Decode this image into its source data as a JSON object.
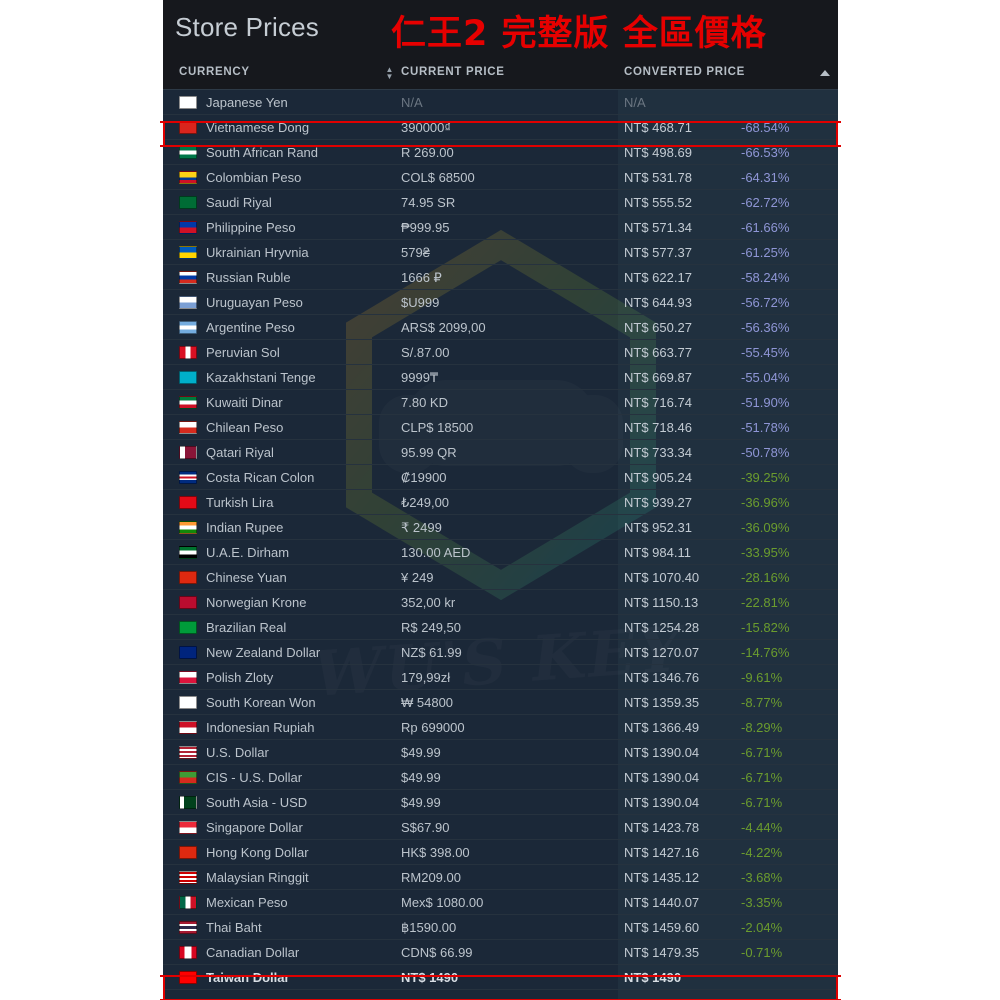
{
  "header": {
    "store_title": "Store Prices",
    "overlay_title": "仁王2 完整版 全區價格",
    "overlay_title_color": "#e60000",
    "columns": {
      "currency": "CURRENCY",
      "current_price": "CURRENT PRICE",
      "converted_price": "CONVERTED PRICE"
    },
    "sort_icons": {
      "currency_sort": "sort-updown-icon",
      "converted_sort": "sort-ascending-icon"
    }
  },
  "watermark": {
    "text": "WU'S KEY",
    "logo": "hexagon-gamepad-logo"
  },
  "colors": {
    "panel_bg": "#1b2838",
    "header_bg": "#16181d",
    "column_highlight_bg": "#20303f",
    "row_divider": "#26323e",
    "text_primary": "#bcc4cc",
    "text_muted": "#6b7682",
    "pct_blue": "#8f96d6",
    "pct_green": "#6b9c2e",
    "highlight_border": "#e00000"
  },
  "highlighted_rows": [
    "Vietnamese Dong",
    "Taiwan Dollar"
  ],
  "base_currency": "Taiwan Dollar",
  "rows": [
    {
      "flag": "jp",
      "currency": "Japanese Yen",
      "current": "N/A",
      "converted": "N/A",
      "pct": "",
      "pct_color": "",
      "na": true
    },
    {
      "flag": "vn",
      "currency": "Vietnamese Dong",
      "current": "390000₫",
      "converted": "NT$ 468.71",
      "pct": "-68.54%",
      "pct_color": "#8f96d6"
    },
    {
      "flag": "za",
      "currency": "South African Rand",
      "current": "R 269.00",
      "converted": "NT$ 498.69",
      "pct": "-66.53%",
      "pct_color": "#8f96d6"
    },
    {
      "flag": "co",
      "currency": "Colombian Peso",
      "current": "COL$ 68500",
      "converted": "NT$ 531.78",
      "pct": "-64.31%",
      "pct_color": "#8f96d6"
    },
    {
      "flag": "sa",
      "currency": "Saudi Riyal",
      "current": "74.95 SR",
      "converted": "NT$ 555.52",
      "pct": "-62.72%",
      "pct_color": "#8f96d6"
    },
    {
      "flag": "ph",
      "currency": "Philippine Peso",
      "current": "₱999.95",
      "converted": "NT$ 571.34",
      "pct": "-61.66%",
      "pct_color": "#8f96d6"
    },
    {
      "flag": "ua",
      "currency": "Ukrainian Hryvnia",
      "current": "579₴",
      "converted": "NT$ 577.37",
      "pct": "-61.25%",
      "pct_color": "#8f96d6"
    },
    {
      "flag": "ru",
      "currency": "Russian Ruble",
      "current": "1666 ₽",
      "converted": "NT$ 622.17",
      "pct": "-58.24%",
      "pct_color": "#8f96d6"
    },
    {
      "flag": "uy",
      "currency": "Uruguayan Peso",
      "current": "$U999",
      "converted": "NT$ 644.93",
      "pct": "-56.72%",
      "pct_color": "#8f96d6"
    },
    {
      "flag": "ar",
      "currency": "Argentine Peso",
      "current": "ARS$ 2099,00",
      "converted": "NT$ 650.27",
      "pct": "-56.36%",
      "pct_color": "#8f96d6"
    },
    {
      "flag": "pe",
      "currency": "Peruvian Sol",
      "current": "S/.87.00",
      "converted": "NT$ 663.77",
      "pct": "-55.45%",
      "pct_color": "#8f96d6"
    },
    {
      "flag": "kz",
      "currency": "Kazakhstani Tenge",
      "current": "9999₸",
      "converted": "NT$ 669.87",
      "pct": "-55.04%",
      "pct_color": "#8f96d6"
    },
    {
      "flag": "kw",
      "currency": "Kuwaiti Dinar",
      "current": "7.80 KD",
      "converted": "NT$ 716.74",
      "pct": "-51.90%",
      "pct_color": "#8f96d6"
    },
    {
      "flag": "cl",
      "currency": "Chilean Peso",
      "current": "CLP$ 18500",
      "converted": "NT$ 718.46",
      "pct": "-51.78%",
      "pct_color": "#8f96d6"
    },
    {
      "flag": "qa",
      "currency": "Qatari Riyal",
      "current": "95.99 QR",
      "converted": "NT$ 733.34",
      "pct": "-50.78%",
      "pct_color": "#8f96d6"
    },
    {
      "flag": "cr",
      "currency": "Costa Rican Colon",
      "current": "₡19900",
      "converted": "NT$ 905.24",
      "pct": "-39.25%",
      "pct_color": "#6b9c2e"
    },
    {
      "flag": "tr",
      "currency": "Turkish Lira",
      "current": "₺249,00",
      "converted": "NT$ 939.27",
      "pct": "-36.96%",
      "pct_color": "#6b9c2e"
    },
    {
      "flag": "in",
      "currency": "Indian Rupee",
      "current": "₹ 2499",
      "converted": "NT$ 952.31",
      "pct": "-36.09%",
      "pct_color": "#6b9c2e"
    },
    {
      "flag": "ae",
      "currency": "U.A.E. Dirham",
      "current": "130.00 AED",
      "converted": "NT$ 984.11",
      "pct": "-33.95%",
      "pct_color": "#6b9c2e"
    },
    {
      "flag": "cn",
      "currency": "Chinese Yuan",
      "current": "¥ 249",
      "converted": "NT$ 1070.40",
      "pct": "-28.16%",
      "pct_color": "#6b9c2e"
    },
    {
      "flag": "no",
      "currency": "Norwegian Krone",
      "current": "352,00 kr",
      "converted": "NT$ 1150.13",
      "pct": "-22.81%",
      "pct_color": "#6b9c2e"
    },
    {
      "flag": "br",
      "currency": "Brazilian Real",
      "current": "R$ 249,50",
      "converted": "NT$ 1254.28",
      "pct": "-15.82%",
      "pct_color": "#6b9c2e"
    },
    {
      "flag": "nz",
      "currency": "New Zealand Dollar",
      "current": "NZ$ 61.99",
      "converted": "NT$ 1270.07",
      "pct": "-14.76%",
      "pct_color": "#6b9c2e"
    },
    {
      "flag": "pl",
      "currency": "Polish Zloty",
      "current": "179,99zł",
      "converted": "NT$ 1346.76",
      "pct": "-9.61%",
      "pct_color": "#6b9c2e"
    },
    {
      "flag": "kr",
      "currency": "South Korean Won",
      "current": "₩ 54800",
      "converted": "NT$ 1359.35",
      "pct": "-8.77%",
      "pct_color": "#6b9c2e"
    },
    {
      "flag": "id",
      "currency": "Indonesian Rupiah",
      "current": "Rp 699000",
      "converted": "NT$ 1366.49",
      "pct": "-8.29%",
      "pct_color": "#6b9c2e"
    },
    {
      "flag": "us",
      "currency": "U.S. Dollar",
      "current": "$49.99",
      "converted": "NT$ 1390.04",
      "pct": "-6.71%",
      "pct_color": "#6b9c2e"
    },
    {
      "flag": "cis",
      "currency": "CIS - U.S. Dollar",
      "current": "$49.99",
      "converted": "NT$ 1390.04",
      "pct": "-6.71%",
      "pct_color": "#6b9c2e"
    },
    {
      "flag": "pk",
      "currency": "South Asia - USD",
      "current": "$49.99",
      "converted": "NT$ 1390.04",
      "pct": "-6.71%",
      "pct_color": "#6b9c2e"
    },
    {
      "flag": "sg",
      "currency": "Singapore Dollar",
      "current": "S$67.90",
      "converted": "NT$ 1423.78",
      "pct": "-4.44%",
      "pct_color": "#6b9c2e"
    },
    {
      "flag": "hk",
      "currency": "Hong Kong Dollar",
      "current": "HK$ 398.00",
      "converted": "NT$ 1427.16",
      "pct": "-4.22%",
      "pct_color": "#6b9c2e"
    },
    {
      "flag": "my",
      "currency": "Malaysian Ringgit",
      "current": "RM209.00",
      "converted": "NT$ 1435.12",
      "pct": "-3.68%",
      "pct_color": "#6b9c2e"
    },
    {
      "flag": "mx",
      "currency": "Mexican Peso",
      "current": "Mex$ 1080.00",
      "converted": "NT$ 1440.07",
      "pct": "-3.35%",
      "pct_color": "#6b9c2e"
    },
    {
      "flag": "th",
      "currency": "Thai Baht",
      "current": "฿1590.00",
      "converted": "NT$ 1459.60",
      "pct": "-2.04%",
      "pct_color": "#6b9c2e"
    },
    {
      "flag": "ca",
      "currency": "Canadian Dollar",
      "current": "CDN$ 66.99",
      "converted": "NT$ 1479.35",
      "pct": "-0.71%",
      "pct_color": "#6b9c2e"
    },
    {
      "flag": "tw",
      "currency": "Taiwan Dollar",
      "current": "NT$ 1490",
      "converted": "NT$ 1490",
      "pct": "",
      "pct_color": "",
      "base": true
    }
  ]
}
